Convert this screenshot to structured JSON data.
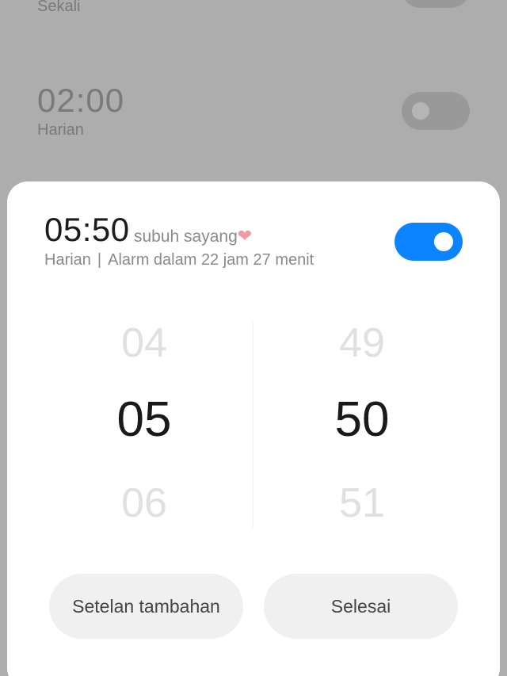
{
  "background_alarms": [
    {
      "time": "",
      "repeat": "Sekali"
    },
    {
      "time": "02:00",
      "repeat": "Harian"
    }
  ],
  "sheet": {
    "time": "05:50",
    "label": "subuh sayang",
    "label_emoji": "❤",
    "repeat": "Harian",
    "separator": "|",
    "info": "Alarm dalam 22 jam 27 menit",
    "enabled": true
  },
  "picker": {
    "hours": {
      "prev": "04",
      "selected": "05",
      "next": "06"
    },
    "minutes": {
      "prev": "49",
      "selected": "50",
      "next": "51"
    }
  },
  "buttons": {
    "more_settings": "Setelan tambahan",
    "done": "Selesai"
  },
  "colors": {
    "accent": "#0d84ff",
    "overlay": "#adadad",
    "heart": "#f29aa2"
  }
}
